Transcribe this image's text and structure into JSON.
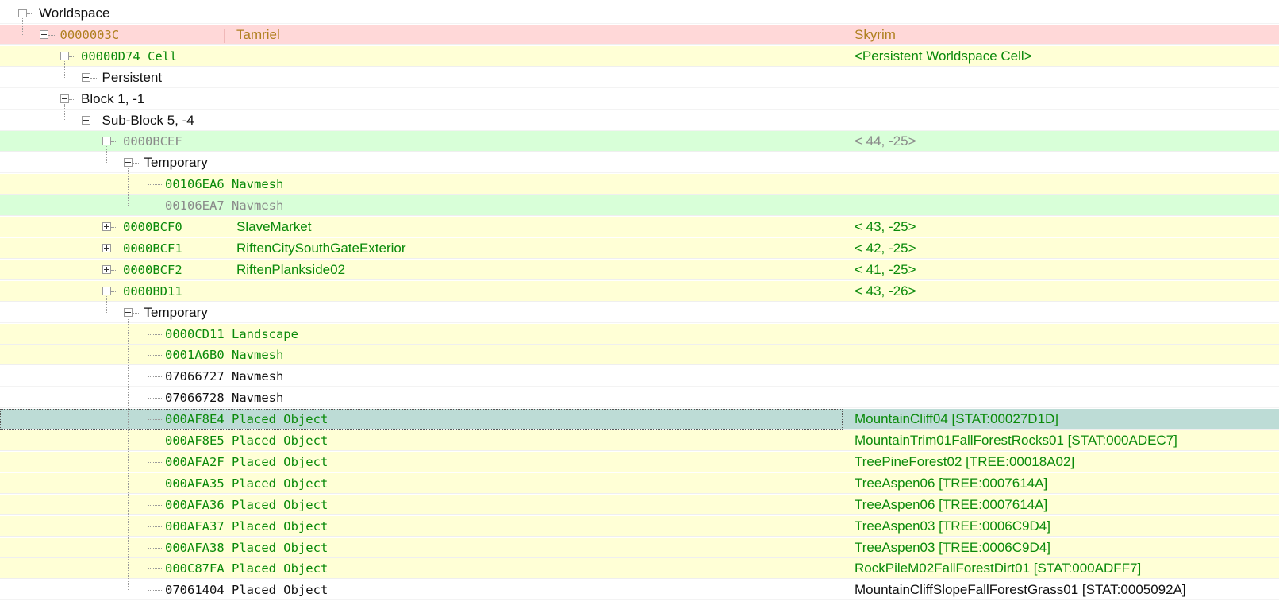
{
  "colors": {
    "pink_row": "#ffd8d8",
    "yellow_row": "#ffffd6",
    "green_row": "#d8ffd8",
    "white_row": "#ffffff",
    "selected_row": "#bddcd6",
    "text_orange": "#b08020",
    "text_green": "#0a8a0a",
    "text_gray": "#8a8a8a",
    "text_black": "#111111"
  },
  "rows": [
    {
      "level": 0,
      "expander": "minus",
      "label": "Worldspace",
      "mono": false,
      "name": "",
      "desc": "",
      "bg": "white_row",
      "color": "text_black"
    },
    {
      "level": 1,
      "expander": "minus",
      "label": "0000003C",
      "mono": true,
      "name": "Tamriel",
      "desc": "Skyrim",
      "bg": "pink_row",
      "color": "text_orange"
    },
    {
      "level": 2,
      "expander": "minus",
      "label": "00000D74 Cell",
      "mono": true,
      "name": "",
      "desc": "<Persistent Worldspace Cell>",
      "bg": "yellow_row",
      "color": "text_green"
    },
    {
      "level": 3,
      "expander": "plus",
      "label": "Persistent",
      "mono": false,
      "name": "",
      "desc": "",
      "bg": "white_row",
      "color": "text_black"
    },
    {
      "level": 2,
      "expander": "minus",
      "label": "Block 1, -1",
      "mono": false,
      "name": "",
      "desc": "",
      "bg": "white_row",
      "color": "text_black"
    },
    {
      "level": 3,
      "expander": "minus",
      "label": "Sub-Block 5, -4",
      "mono": false,
      "name": "",
      "desc": "",
      "bg": "white_row",
      "color": "text_black"
    },
    {
      "level": 4,
      "expander": "minus",
      "label": "0000BCEF",
      "mono": true,
      "name": "",
      "desc": "< 44, -25>",
      "bg": "green_row",
      "color": "text_gray"
    },
    {
      "level": 5,
      "expander": "minus",
      "label": "Temporary",
      "mono": false,
      "name": "",
      "desc": "",
      "bg": "white_row",
      "color": "text_black"
    },
    {
      "level": 6,
      "expander": "none",
      "label": "00106EA6 Navmesh",
      "mono": true,
      "name": "",
      "desc": "",
      "bg": "yellow_row",
      "color": "text_green"
    },
    {
      "level": 6,
      "expander": "none",
      "label": "00106EA7 Navmesh",
      "mono": true,
      "name": "",
      "desc": "",
      "bg": "green_row",
      "color": "text_gray"
    },
    {
      "level": 4,
      "expander": "plus",
      "label": "0000BCF0",
      "mono": true,
      "name": "SlaveMarket",
      "desc": "< 43, -25>",
      "bg": "yellow_row",
      "color": "text_green"
    },
    {
      "level": 4,
      "expander": "plus",
      "label": "0000BCF1",
      "mono": true,
      "name": "RiftenCitySouthGateExterior",
      "desc": "< 42, -25>",
      "bg": "yellow_row",
      "color": "text_green"
    },
    {
      "level": 4,
      "expander": "plus",
      "label": "0000BCF2",
      "mono": true,
      "name": "RiftenPlankside02",
      "desc": "< 41, -25>",
      "bg": "yellow_row",
      "color": "text_green"
    },
    {
      "level": 4,
      "expander": "minus",
      "label": "0000BD11",
      "mono": true,
      "name": "",
      "desc": "< 43, -26>",
      "bg": "yellow_row",
      "color": "text_green"
    },
    {
      "level": 5,
      "expander": "minus",
      "label": "Temporary",
      "mono": false,
      "name": "",
      "desc": "",
      "bg": "white_row",
      "color": "text_black"
    },
    {
      "level": 6,
      "expander": "none",
      "label": "0000CD11 Landscape",
      "mono": true,
      "name": "",
      "desc": "",
      "bg": "yellow_row",
      "color": "text_green"
    },
    {
      "level": 6,
      "expander": "none",
      "label": "0001A6B0 Navmesh",
      "mono": true,
      "name": "",
      "desc": "",
      "bg": "yellow_row",
      "color": "text_green"
    },
    {
      "level": 6,
      "expander": "none",
      "label": "07066727 Navmesh",
      "mono": true,
      "name": "",
      "desc": "",
      "bg": "white_row",
      "color": "text_black"
    },
    {
      "level": 6,
      "expander": "none",
      "label": "07066728 Navmesh",
      "mono": true,
      "name": "",
      "desc": "",
      "bg": "white_row",
      "color": "text_black"
    },
    {
      "level": 6,
      "expander": "none",
      "label": "000AF8E4 Placed Object",
      "mono": true,
      "name": "",
      "desc": "MountainCliff04 [STAT:00027D1D]",
      "bg": "selected_row",
      "color": "text_green",
      "selected": true
    },
    {
      "level": 6,
      "expander": "none",
      "label": "000AF8E5 Placed Object",
      "mono": true,
      "name": "",
      "desc": "MountainTrim01FallForestRocks01 [STAT:000ADEC7]",
      "bg": "yellow_row",
      "color": "text_green"
    },
    {
      "level": 6,
      "expander": "none",
      "label": "000AFA2F Placed Object",
      "mono": true,
      "name": "",
      "desc": "TreePineForest02 [TREE:00018A02]",
      "bg": "yellow_row",
      "color": "text_green"
    },
    {
      "level": 6,
      "expander": "none",
      "label": "000AFA35 Placed Object",
      "mono": true,
      "name": "",
      "desc": "TreeAspen06 [TREE:0007614A]",
      "bg": "yellow_row",
      "color": "text_green"
    },
    {
      "level": 6,
      "expander": "none",
      "label": "000AFA36 Placed Object",
      "mono": true,
      "name": "",
      "desc": "TreeAspen06 [TREE:0007614A]",
      "bg": "yellow_row",
      "color": "text_green"
    },
    {
      "level": 6,
      "expander": "none",
      "label": "000AFA37 Placed Object",
      "mono": true,
      "name": "",
      "desc": "TreeAspen03 [TREE:0006C9D4]",
      "bg": "yellow_row",
      "color": "text_green"
    },
    {
      "level": 6,
      "expander": "none",
      "label": "000AFA38 Placed Object",
      "mono": true,
      "name": "",
      "desc": "TreeAspen03 [TREE:0006C9D4]",
      "bg": "yellow_row",
      "color": "text_green"
    },
    {
      "level": 6,
      "expander": "none",
      "label": "000C87FA Placed Object",
      "mono": true,
      "name": "",
      "desc": "RockPileM02FallForestDirt01 [STAT:000ADFF7]",
      "bg": "yellow_row",
      "color": "text_green"
    },
    {
      "level": 6,
      "expander": "none",
      "label": "07061404 Placed Object",
      "mono": true,
      "name": "",
      "desc": "MountainCliffSlopeFallForestGrass01 [STAT:0005092A]",
      "bg": "white_row",
      "color": "text_black"
    }
  ]
}
